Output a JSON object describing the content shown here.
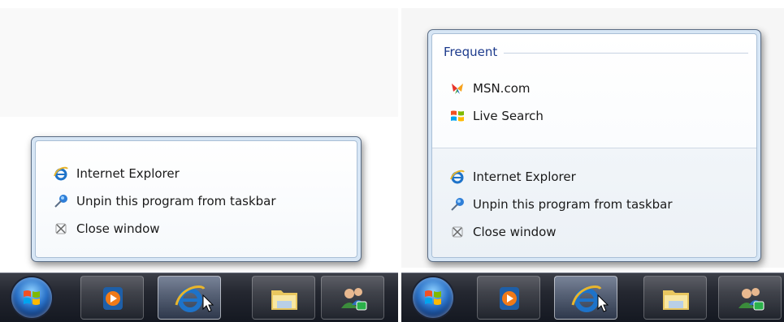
{
  "left_jumplist": {
    "tasks": [
      {
        "icon": "internet-explorer-icon",
        "label": "Internet Explorer"
      },
      {
        "icon": "unpin-icon",
        "label": "Unpin this program from taskbar"
      },
      {
        "icon": "close-window-icon",
        "label": "Close window"
      }
    ]
  },
  "right_jumplist": {
    "frequent_header": "Frequent",
    "frequent_items": [
      {
        "icon": "msn-butterfly-icon",
        "label": "MSN.com"
      },
      {
        "icon": "windows-live-search-icon",
        "label": "Live Search"
      }
    ],
    "tasks": [
      {
        "icon": "internet-explorer-icon",
        "label": "Internet Explorer"
      },
      {
        "icon": "unpin-icon",
        "label": "Unpin this program from taskbar"
      },
      {
        "icon": "close-window-icon",
        "label": "Close window"
      }
    ]
  },
  "taskbar": {
    "buttons": [
      {
        "icon": "windows-start-orb-icon"
      },
      {
        "icon": "media-player-icon"
      },
      {
        "icon": "internet-explorer-icon",
        "active": true
      },
      {
        "icon": "windows-explorer-folder-icon"
      },
      {
        "icon": "users-icon"
      }
    ]
  },
  "colors": {
    "frequent_header": "#1c3a8c",
    "jumplist_border": "#5a6c84",
    "taskbar": "#1c2029"
  }
}
